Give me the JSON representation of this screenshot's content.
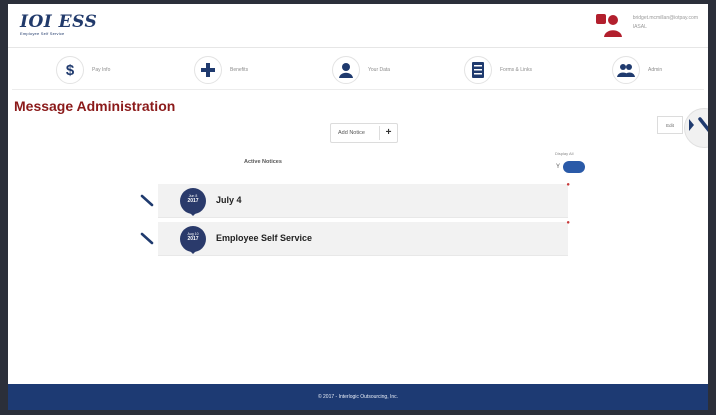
{
  "app": {
    "logo": "IOI ESS",
    "logo_sub": "Employee Self Service"
  },
  "user": {
    "email": "bridget.mcmillan@iotpay.com",
    "company": "IASAL"
  },
  "nav": {
    "items": [
      {
        "label": "Pay Info",
        "icon": "dollar-icon"
      },
      {
        "label": "Benefits",
        "icon": "plus-icon"
      },
      {
        "label": "Your Data",
        "icon": "person-icon"
      },
      {
        "label": "Forms & Links",
        "icon": "document-icon"
      },
      {
        "label": "Admin",
        "icon": "users-icon"
      }
    ]
  },
  "page": {
    "title": "Message Administration",
    "add_notice_label": "Add Notice",
    "add_notice_icon": "+",
    "edit_label": "Edit",
    "active_notices_label": "Active Notices",
    "display_all_label": "Display All",
    "toggle_label": "Y"
  },
  "notices": [
    {
      "badge_top": "Jun 8",
      "badge_year": "2017",
      "title": "July 4"
    },
    {
      "badge_top": "Aug 10",
      "badge_year": "2017",
      "title": "Employee Self Service"
    }
  ],
  "footer": {
    "text": "© 2017 - Interlogic Outsourcing, Inc."
  },
  "colors": {
    "brand_navy": "#1d3a73",
    "title_red": "#8b1a1a",
    "toggle_blue": "#2a5aa8"
  }
}
